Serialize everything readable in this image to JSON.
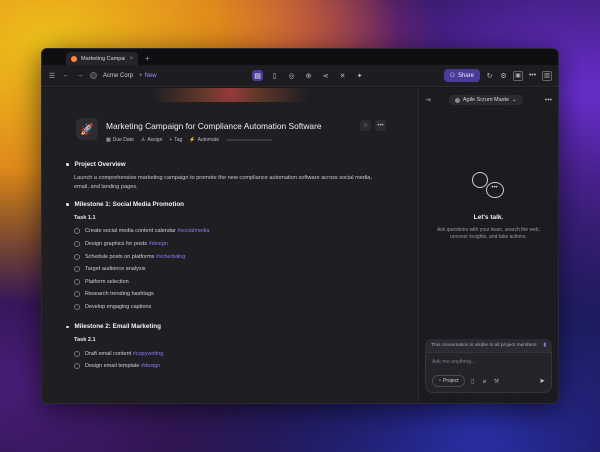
{
  "browser": {
    "tab_title": "Marketing Campaign ...",
    "tab_close": "×",
    "tab_add": "+"
  },
  "toolbar": {
    "workspace": "Acme Corp",
    "new_label": "New",
    "share_label": "Share",
    "icons": [
      "sidebar-icon",
      "back-icon",
      "forward-icon",
      "board-icon",
      "doc-icon",
      "target-icon",
      "globe-icon",
      "share-node-icon",
      "compress-icon",
      "puzzle-icon"
    ]
  },
  "document": {
    "emoji": "🚀",
    "title": "Marketing Campaign for Compliance Automation Software",
    "meta": {
      "due_date": "Due Date",
      "assign": "Assign",
      "tag": "Tag",
      "automate": "Automate"
    },
    "sections": [
      {
        "heading": "Project Overview",
        "paragraph": "Launch a comprehensive marketing campaign to promote the new compliance automation software across social media, email, and landing pages."
      },
      {
        "heading": "Milestone 1: Social Media Promotion",
        "task_label": "Task 1.1",
        "items": [
          {
            "text": "Create social media content calendar ",
            "tag": "#socialmedia"
          },
          {
            "text": "Design graphics for posts ",
            "tag": "#design"
          },
          {
            "text": "Schedule posts on platforms ",
            "tag": "#scheduling"
          },
          {
            "text": "Target audience analysis",
            "tag": ""
          },
          {
            "text": "Platform selection",
            "tag": ""
          },
          {
            "text": "Research trending hashtags",
            "tag": ""
          },
          {
            "text": "Develop engaging captions",
            "tag": ""
          }
        ]
      },
      {
        "heading": "Milestone 2: Email Marketing",
        "task_label": "Task 2.1",
        "items": [
          {
            "text": "Draft email content ",
            "tag": "#copywriting"
          },
          {
            "text": "Design email template ",
            "tag": "#design"
          }
        ]
      }
    ]
  },
  "chat": {
    "agent": "Agile Scrum Maste",
    "empty_title": "Let's talk.",
    "empty_sub": "Ask questions with your team, search the web, uncover insights, and take actions.",
    "notice": "This conversation is visible to all project members.",
    "placeholder": "Ask me anything...",
    "project_chip": "Project"
  }
}
